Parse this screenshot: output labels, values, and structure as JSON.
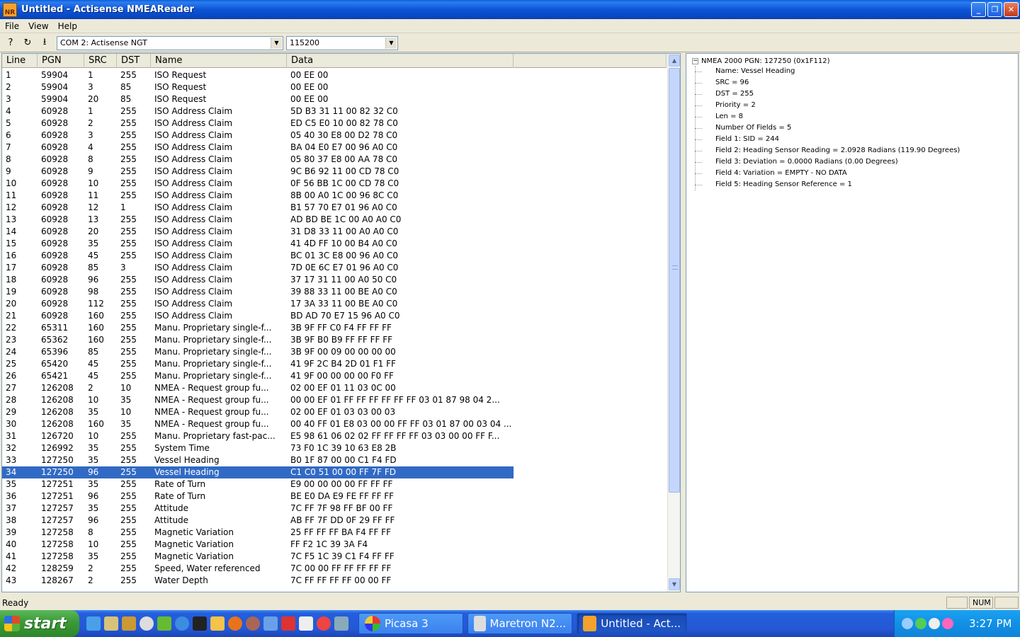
{
  "window": {
    "title": "Untitled - Actisense NMEAReader",
    "app_icon_text": "NR",
    "minimize": "_",
    "maximize": "❐",
    "close": "✕"
  },
  "menu": {
    "file": "File",
    "view": "View",
    "help": "Help"
  },
  "toolbar": {
    "port": "COM 2: Actisense NGT",
    "baud": "115200"
  },
  "list": {
    "headers": {
      "line": "Line",
      "pgn": "PGN",
      "src": "SRC",
      "dst": "DST",
      "name": "Name",
      "data": "Data"
    },
    "rows": [
      {
        "line": "1",
        "pgn": "59904",
        "src": "1",
        "dst": "255",
        "name": "ISO Request",
        "data": "00 EE 00"
      },
      {
        "line": "2",
        "pgn": "59904",
        "src": "3",
        "dst": "85",
        "name": "ISO Request",
        "data": "00 EE 00"
      },
      {
        "line": "3",
        "pgn": "59904",
        "src": "20",
        "dst": "85",
        "name": "ISO Request",
        "data": "00 EE 00"
      },
      {
        "line": "4",
        "pgn": "60928",
        "src": "1",
        "dst": "255",
        "name": "ISO Address Claim",
        "data": "5D B3 31 11 00 82 32 C0"
      },
      {
        "line": "5",
        "pgn": "60928",
        "src": "2",
        "dst": "255",
        "name": "ISO Address Claim",
        "data": "ED C5 E0 10 00 82 78 C0"
      },
      {
        "line": "6",
        "pgn": "60928",
        "src": "3",
        "dst": "255",
        "name": "ISO Address Claim",
        "data": "05 40 30 E8 00 D2 78 C0"
      },
      {
        "line": "7",
        "pgn": "60928",
        "src": "4",
        "dst": "255",
        "name": "ISO Address Claim",
        "data": "BA 04 E0 E7 00 96 A0 C0"
      },
      {
        "line": "8",
        "pgn": "60928",
        "src": "8",
        "dst": "255",
        "name": "ISO Address Claim",
        "data": "05 80 37 E8 00 AA 78 C0"
      },
      {
        "line": "9",
        "pgn": "60928",
        "src": "9",
        "dst": "255",
        "name": "ISO Address Claim",
        "data": "9C B6 92 11 00 CD 78 C0"
      },
      {
        "line": "10",
        "pgn": "60928",
        "src": "10",
        "dst": "255",
        "name": "ISO Address Claim",
        "data": "0F 56 BB 1C 00 CD 78 C0"
      },
      {
        "line": "11",
        "pgn": "60928",
        "src": "11",
        "dst": "255",
        "name": "ISO Address Claim",
        "data": "8B 00 A0 1C 00 96 8C C0"
      },
      {
        "line": "12",
        "pgn": "60928",
        "src": "12",
        "dst": "1",
        "name": "ISO Address Claim",
        "data": "B1 57 70 E7 01 96 A0 C0"
      },
      {
        "line": "13",
        "pgn": "60928",
        "src": "13",
        "dst": "255",
        "name": "ISO Address Claim",
        "data": "AD BD BE 1C 00 A0 A0 C0"
      },
      {
        "line": "14",
        "pgn": "60928",
        "src": "20",
        "dst": "255",
        "name": "ISO Address Claim",
        "data": "31 D8 33 11 00 A0 A0 C0"
      },
      {
        "line": "15",
        "pgn": "60928",
        "src": "35",
        "dst": "255",
        "name": "ISO Address Claim",
        "data": "41 4D FF 10 00 B4 A0 C0"
      },
      {
        "line": "16",
        "pgn": "60928",
        "src": "45",
        "dst": "255",
        "name": "ISO Address Claim",
        "data": "BC 01 3C E8 00 96 A0 C0"
      },
      {
        "line": "17",
        "pgn": "60928",
        "src": "85",
        "dst": "3",
        "name": "ISO Address Claim",
        "data": "7D 0E 6C E7 01 96 A0 C0"
      },
      {
        "line": "18",
        "pgn": "60928",
        "src": "96",
        "dst": "255",
        "name": "ISO Address Claim",
        "data": "37 17 31 11 00 A0 50 C0"
      },
      {
        "line": "19",
        "pgn": "60928",
        "src": "98",
        "dst": "255",
        "name": "ISO Address Claim",
        "data": "39 88 33 11 00 BE A0 C0"
      },
      {
        "line": "20",
        "pgn": "60928",
        "src": "112",
        "dst": "255",
        "name": "ISO Address Claim",
        "data": "17 3A 33 11 00 BE A0 C0"
      },
      {
        "line": "21",
        "pgn": "60928",
        "src": "160",
        "dst": "255",
        "name": "ISO Address Claim",
        "data": "BD AD 70 E7 15 96 A0 C0"
      },
      {
        "line": "22",
        "pgn": "65311",
        "src": "160",
        "dst": "255",
        "name": "Manu. Proprietary single-f...",
        "data": "3B 9F FF C0 F4 FF FF FF"
      },
      {
        "line": "23",
        "pgn": "65362",
        "src": "160",
        "dst": "255",
        "name": "Manu. Proprietary single-f...",
        "data": "3B 9F B0 B9 FF FF FF FF"
      },
      {
        "line": "24",
        "pgn": "65396",
        "src": "85",
        "dst": "255",
        "name": "Manu. Proprietary single-f...",
        "data": "3B 9F 00 09 00 00 00 00"
      },
      {
        "line": "25",
        "pgn": "65420",
        "src": "45",
        "dst": "255",
        "name": "Manu. Proprietary single-f...",
        "data": "41 9F 2C B4 2D 01 F1 FF"
      },
      {
        "line": "26",
        "pgn": "65421",
        "src": "45",
        "dst": "255",
        "name": "Manu. Proprietary single-f...",
        "data": "41 9F 00 00 00 00 F0 FF"
      },
      {
        "line": "27",
        "pgn": "126208",
        "src": "2",
        "dst": "10",
        "name": "NMEA - Request group fu...",
        "data": "02 00 EF 01 11 03 0C 00"
      },
      {
        "line": "28",
        "pgn": "126208",
        "src": "10",
        "dst": "35",
        "name": "NMEA - Request group fu...",
        "data": "00 00 EF 01 FF FF FF FF FF FF 03 01 87 98 04 2..."
      },
      {
        "line": "29",
        "pgn": "126208",
        "src": "35",
        "dst": "10",
        "name": "NMEA - Request group fu...",
        "data": "02 00 EF 01 03 03 00 03"
      },
      {
        "line": "30",
        "pgn": "126208",
        "src": "160",
        "dst": "35",
        "name": "NMEA - Request group fu...",
        "data": "00 40 FF 01 E8 03 00 00 FF FF 03 01 87 00 03 04 ..."
      },
      {
        "line": "31",
        "pgn": "126720",
        "src": "10",
        "dst": "255",
        "name": "Manu. Proprietary fast-pac...",
        "data": "E5 98 61 06 02 02 FF FF FF FF 03 03 00 00 FF F..."
      },
      {
        "line": "32",
        "pgn": "126992",
        "src": "35",
        "dst": "255",
        "name": "System Time",
        "data": "73 F0 1C 39 10 63 E8 2B"
      },
      {
        "line": "33",
        "pgn": "127250",
        "src": "35",
        "dst": "255",
        "name": "Vessel Heading",
        "data": "B0 1F 87 00 00 C1 F4 FD"
      },
      {
        "line": "34",
        "pgn": "127250",
        "src": "96",
        "dst": "255",
        "name": "Vessel Heading",
        "data": "C1 C0 51 00 00 FF 7F FD",
        "selected": true
      },
      {
        "line": "35",
        "pgn": "127251",
        "src": "35",
        "dst": "255",
        "name": "Rate of Turn",
        "data": "E9 00 00 00 00 FF FF FF"
      },
      {
        "line": "36",
        "pgn": "127251",
        "src": "96",
        "dst": "255",
        "name": "Rate of Turn",
        "data": "BE E0 DA E9 FE FF FF FF"
      },
      {
        "line": "37",
        "pgn": "127257",
        "src": "35",
        "dst": "255",
        "name": "Attitude",
        "data": "7C FF 7F 98 FF BF 00 FF"
      },
      {
        "line": "38",
        "pgn": "127257",
        "src": "96",
        "dst": "255",
        "name": "Attitude",
        "data": "AB FF 7F DD 0F 29 FF FF"
      },
      {
        "line": "39",
        "pgn": "127258",
        "src": "8",
        "dst": "255",
        "name": "Magnetic Variation",
        "data": "25 FF FF FF BA F4 FF FF"
      },
      {
        "line": "40",
        "pgn": "127258",
        "src": "10",
        "dst": "255",
        "name": "Magnetic Variation",
        "data": "FF F2 1C 39 3A F4"
      },
      {
        "line": "41",
        "pgn": "127258",
        "src": "35",
        "dst": "255",
        "name": "Magnetic Variation",
        "data": "7C F5 1C 39 C1 F4 FF FF"
      },
      {
        "line": "42",
        "pgn": "128259",
        "src": "2",
        "dst": "255",
        "name": "Speed, Water referenced",
        "data": "7C 00 00 FF FF FF FF FF"
      },
      {
        "line": "43",
        "pgn": "128267",
        "src": "2",
        "dst": "255",
        "name": "Water Depth",
        "data": "7C FF FF FF FF 00 00 FF"
      }
    ]
  },
  "tree": {
    "root": "NMEA 2000 PGN: 127250 (0x1F112)",
    "children": [
      "Name: Vessel Heading",
      "SRC = 96",
      "DST = 255",
      "Priority = 2",
      "Len = 8",
      "Number Of Fields = 5",
      "Field 1: SID = 244",
      "Field 2: Heading Sensor Reading = 2.0928 Radians (119.90 Degrees)",
      "Field 3: Deviation = 0.0000 Radians (0.00 Degrees)",
      "Field 4: Variation = EMPTY - NO DATA",
      "Field 5: Heading Sensor Reference = 1"
    ]
  },
  "status": {
    "ready": "Ready",
    "num": "NUM"
  },
  "taskbar": {
    "start": "start",
    "tasks": [
      "Picasa 3",
      "Maretron N2...",
      "Untitled - Act..."
    ],
    "clock": "3:27 PM"
  }
}
